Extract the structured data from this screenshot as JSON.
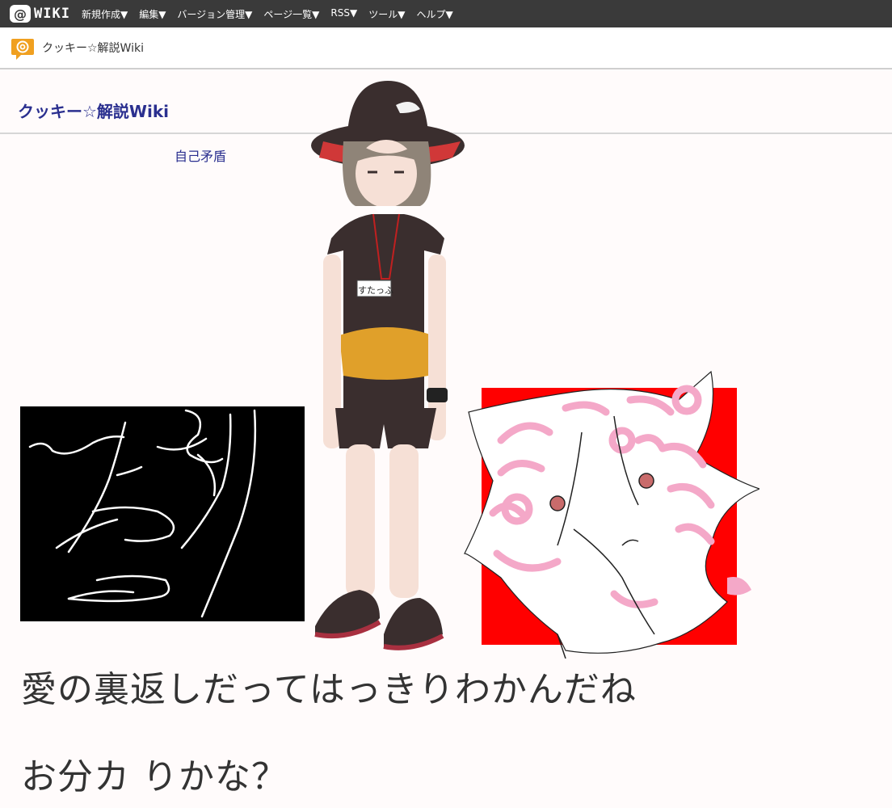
{
  "header": {
    "logo_at": "@",
    "logo_text": "WIKI",
    "menu": [
      "新規作成▼",
      "編集▼",
      "バージョン管理▼",
      "ページ一覧▼",
      "RSS▼",
      "ツール▼",
      "ヘルプ▼"
    ]
  },
  "site": {
    "name": "クッキー☆解説Wiki"
  },
  "page": {
    "title": "クッキー☆解説Wiki",
    "link": "自己矛盾",
    "badge": "すたっふ",
    "line1": "愛の裏返しだってはっきりわかんだね",
    "line2": "お分カ りかな？"
  },
  "colors": {
    "toolbar": "#3a3a3a",
    "accent_orange": "#f0a020",
    "title_blue": "#2a2f8f",
    "red_panel": "#ff0000"
  }
}
